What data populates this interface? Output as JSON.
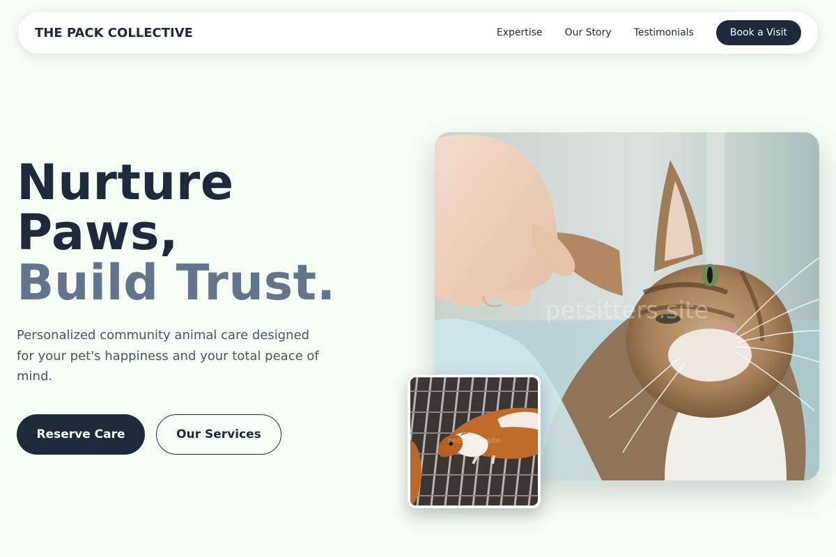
{
  "nav": {
    "brand": "THE PACK COLLECTIVE",
    "links": [
      "Expertise",
      "Our Story",
      "Testimonials"
    ],
    "cta": "Book a Visit"
  },
  "hero": {
    "title_lines": [
      "Nurture",
      "Paws,"
    ],
    "title_accent": "Build Trust.",
    "description": "Personalized community animal care designed for your pet's happiness and your total peace of mind.",
    "primary_button": "Reserve Care",
    "secondary_button": "Our Services"
  },
  "images": {
    "main_alt": "Hand scratching a tabby cat behind the ear",
    "main_watermark": "petsitters.site",
    "thumb_alt": "Guinea pig on a wire cage floor",
    "thumb_watermark": "petsitters.site"
  },
  "colors": {
    "background": "#f5fdf4",
    "primary": "#1e293b",
    "accent_text": "#64748b",
    "body_text": "#475569"
  }
}
